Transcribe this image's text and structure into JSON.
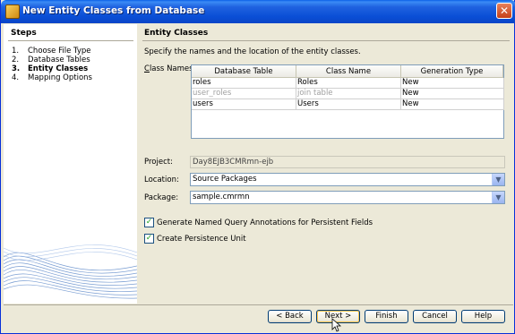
{
  "window": {
    "title": "New Entity Classes from Database",
    "close_glyph": "✕"
  },
  "steps": {
    "title": "Steps",
    "items": [
      {
        "num": "1.",
        "label": "Choose File Type"
      },
      {
        "num": "2.",
        "label": "Database Tables"
      },
      {
        "num": "3.",
        "label": "Entity Classes",
        "active": true
      },
      {
        "num": "4.",
        "label": "Mapping Options"
      }
    ]
  },
  "panel": {
    "title": "Entity Classes",
    "description": "Specify the names and the location of the entity classes.",
    "class_names_label": "Class Names:",
    "table": {
      "headers": [
        "Database Table",
        "Class Name",
        "Generation Type"
      ],
      "rows": [
        {
          "table": "roles",
          "class": "Roles",
          "type": "New",
          "greyed": false
        },
        {
          "table": "user_roles",
          "class": "join table",
          "type": "New",
          "greyed": true
        },
        {
          "table": "users",
          "class": "Users",
          "type": "New",
          "greyed": false
        }
      ]
    },
    "project_label": "Project:",
    "project_value": "Day8EJB3CMRmn-ejb",
    "location_label": "Location:",
    "location_value": "Source Packages",
    "package_label": "Package:",
    "package_value": "sample.cmrmn",
    "checkbox_named_queries": "Generate Named Query Annotations for Persistent Fields",
    "checkbox_persistence_unit": "Create Persistence Unit",
    "checkbox_named_queries_checked": true,
    "checkbox_persistence_unit_checked": true,
    "check_glyph": "✓",
    "combo_arrow_glyph": "▼"
  },
  "buttons": {
    "back": "< Back",
    "next": "Next >",
    "finish": "Finish",
    "cancel": "Cancel",
    "help": "Help"
  },
  "colors": {
    "title_bar": "#0a4fd6",
    "dialog_bg": "#ece9d8",
    "field_border": "#7f9db9"
  }
}
